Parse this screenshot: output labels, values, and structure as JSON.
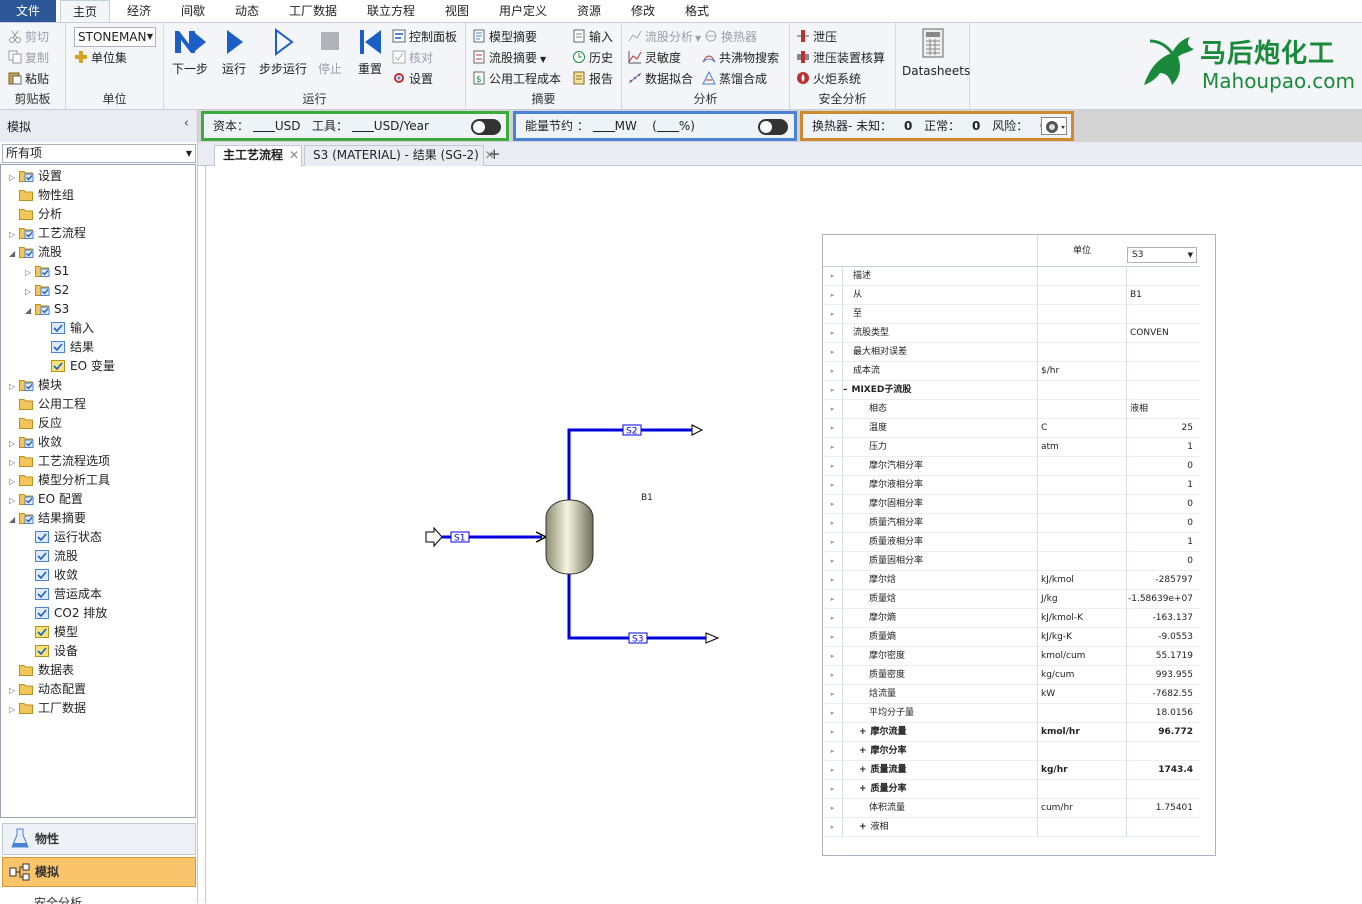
{
  "menu": {
    "file": "文件",
    "tabs": [
      "主页",
      "经济",
      "间歇",
      "动态",
      "工厂数据",
      "联立方程",
      "视图",
      "用户定义",
      "资源",
      "修改",
      "格式"
    ]
  },
  "ribbon": {
    "clipboard": {
      "label": "剪贴板",
      "cut": "剪切",
      "copy": "复制",
      "paste": "粘贴"
    },
    "units": {
      "label": "单位",
      "select": "STONEMAN",
      "unit_sets": "单位集"
    },
    "run": {
      "label": "运行",
      "next": "下一步",
      "run": "运行",
      "step": "步步运行",
      "stop": "停止",
      "reset": "重置",
      "control_panel": "控制面板",
      "check": "核对",
      "settings": "设置"
    },
    "summary": {
      "label": "摘要",
      "model_summary": "模型摘要",
      "stream_summary": "流股摘要",
      "utility_cost": "公用工程成本",
      "input": "输入",
      "history": "历史",
      "report": "报告"
    },
    "analysis": {
      "label": "分析",
      "stream_analysis": "流股分析",
      "hx": "换热器",
      "sensitivity": "灵敏度",
      "azeotrope": "共沸物搜索",
      "data_fit": "数据拟合",
      "distill_synth": "蒸馏合成"
    },
    "safety": {
      "label": "安全分析",
      "relief": "泄压",
      "relief_rating": "泄压装置核算",
      "flare": "火炬系统"
    },
    "datasheets": "Datasheets",
    "logo_cn": "马后炮化工",
    "logo_en": "Mahoupao.com"
  },
  "infobar": {
    "sidebar_title": "模拟",
    "capital_label": "资本：",
    "capital_unit": "USD",
    "utility_label": "工具：",
    "utility_unit": "USD/Year",
    "energy_label": "能量节约 ：",
    "energy_unit": "MW",
    "energy_pct": "%)",
    "energy_paren": "(",
    "hx_label": "换热器- 未知：",
    "hx_unknown": "0",
    "hx_ok_label": "正常：",
    "hx_ok": "0",
    "hx_risk_label": "风险：",
    "hx_risk": "0"
  },
  "sidebar": {
    "filter": "所有项",
    "tree": [
      {
        "label": "设置",
        "level": 0,
        "exp": "▷",
        "icon": "folder-check"
      },
      {
        "label": "物性组",
        "level": 0,
        "exp": "",
        "icon": "folder"
      },
      {
        "label": "分析",
        "level": 0,
        "exp": "",
        "icon": "folder"
      },
      {
        "label": "工艺流程",
        "level": 0,
        "exp": "▷",
        "icon": "folder-check"
      },
      {
        "label": "流股",
        "level": 0,
        "exp": "◢",
        "icon": "folder-check"
      },
      {
        "label": "S1",
        "level": 1,
        "exp": "▷",
        "icon": "folder-check"
      },
      {
        "label": "S2",
        "level": 1,
        "exp": "▷",
        "icon": "folder-check"
      },
      {
        "label": "S3",
        "level": 1,
        "exp": "◢",
        "icon": "folder-check"
      },
      {
        "label": "输入",
        "level": 2,
        "exp": "",
        "icon": "form-check"
      },
      {
        "label": "结果",
        "level": 2,
        "exp": "",
        "icon": "form"
      },
      {
        "label": "EO 变量",
        "level": 2,
        "exp": "",
        "icon": "form-yellow"
      },
      {
        "label": "模块",
        "level": 0,
        "exp": "▷",
        "icon": "folder-check"
      },
      {
        "label": "公用工程",
        "level": 0,
        "exp": "",
        "icon": "folder"
      },
      {
        "label": "反应",
        "level": 0,
        "exp": "",
        "icon": "folder"
      },
      {
        "label": "收敛",
        "level": 0,
        "exp": "▷",
        "icon": "folder-check"
      },
      {
        "label": "工艺流程选项",
        "level": 0,
        "exp": "▷",
        "icon": "folder"
      },
      {
        "label": "模型分析工具",
        "level": 0,
        "exp": "▷",
        "icon": "folder"
      },
      {
        "label": "EO 配置",
        "level": 0,
        "exp": "▷",
        "icon": "folder-check"
      },
      {
        "label": "结果摘要",
        "level": 0,
        "exp": "◢",
        "icon": "folder-check"
      },
      {
        "label": "运行状态",
        "level": 1,
        "exp": "",
        "icon": "form-check"
      },
      {
        "label": "流股",
        "level": 1,
        "exp": "",
        "icon": "form-check"
      },
      {
        "label": "收敛",
        "level": 1,
        "exp": "",
        "icon": "form"
      },
      {
        "label": "营运成本",
        "level": 1,
        "exp": "",
        "icon": "form-check"
      },
      {
        "label": "CO2 排放",
        "level": 1,
        "exp": "",
        "icon": "form-check"
      },
      {
        "label": "模型",
        "level": 1,
        "exp": "",
        "icon": "form-yellow"
      },
      {
        "label": "设备",
        "level": 1,
        "exp": "",
        "icon": "form-yellow"
      },
      {
        "label": "数据表",
        "level": 0,
        "exp": "",
        "icon": "folder"
      },
      {
        "label": "动态配置",
        "level": 0,
        "exp": "▷",
        "icon": "folder"
      },
      {
        "label": "工厂数据",
        "level": 0,
        "exp": "▷",
        "icon": "folder"
      }
    ],
    "nav_physical": "物性",
    "nav_simulation": "模拟",
    "nav_safety": "安全分析"
  },
  "doc_tabs": [
    {
      "label": "主工艺流程",
      "active": true
    },
    {
      "label": "S3 (MATERIAL) - 结果 (SG-2)",
      "active": false
    }
  ],
  "flowsheet": {
    "block": "B1",
    "streams": [
      "S1",
      "S2",
      "S3"
    ],
    "stream_color": "#0000dd"
  },
  "stream_table": {
    "unit_header": "单位",
    "selected_stream": "S3",
    "rows": [
      {
        "label": "描述",
        "unit": "",
        "value": "",
        "indent": 0,
        "exp": "▸",
        "bold": false,
        "align": "left"
      },
      {
        "label": "从",
        "unit": "",
        "value": "B1",
        "indent": 0,
        "exp": "▸",
        "bold": false,
        "align": "left"
      },
      {
        "label": "至",
        "unit": "",
        "value": "",
        "indent": 0,
        "exp": "▸",
        "bold": false,
        "align": "left"
      },
      {
        "label": "流股类型",
        "unit": "",
        "value": "CONVEN",
        "indent": 0,
        "exp": "▸",
        "bold": false,
        "align": "left"
      },
      {
        "label": "最大相对误差",
        "unit": "",
        "value": "",
        "indent": 0,
        "exp": "▸",
        "bold": false,
        "align": "left"
      },
      {
        "label": "成本流",
        "unit": "$/hr",
        "value": "",
        "indent": 0,
        "exp": "▸",
        "bold": false,
        "align": "left"
      },
      {
        "label": "MIXED子流股",
        "unit": "",
        "value": "",
        "indent": 0,
        "exp": "▸",
        "bold": true,
        "align": "left",
        "prefix": "–"
      },
      {
        "label": "相态",
        "unit": "",
        "value": "液相",
        "indent": 1,
        "exp": "▸",
        "bold": false,
        "align": "left"
      },
      {
        "label": "温度",
        "unit": "C",
        "value": "25",
        "indent": 1,
        "exp": "▸",
        "bold": false,
        "align": "right"
      },
      {
        "label": "压力",
        "unit": "atm",
        "value": "1",
        "indent": 1,
        "exp": "▸",
        "bold": false,
        "align": "right"
      },
      {
        "label": "摩尔汽相分率",
        "unit": "",
        "value": "0",
        "indent": 1,
        "exp": "▸",
        "bold": false,
        "align": "right"
      },
      {
        "label": "摩尔液相分率",
        "unit": "",
        "value": "1",
        "indent": 1,
        "exp": "▸",
        "bold": false,
        "align": "right"
      },
      {
        "label": "摩尔固相分率",
        "unit": "",
        "value": "0",
        "indent": 1,
        "exp": "▸",
        "bold": false,
        "align": "right"
      },
      {
        "label": "质量汽相分率",
        "unit": "",
        "value": "0",
        "indent": 1,
        "exp": "▸",
        "bold": false,
        "align": "right"
      },
      {
        "label": "质量液相分率",
        "unit": "",
        "value": "1",
        "indent": 1,
        "exp": "▸",
        "bold": false,
        "align": "right"
      },
      {
        "label": "质量固相分率",
        "unit": "",
        "value": "0",
        "indent": 1,
        "exp": "▸",
        "bold": false,
        "align": "right"
      },
      {
        "label": "摩尔焓",
        "unit": "kJ/kmol",
        "value": "-285797",
        "indent": 1,
        "exp": "▸",
        "bold": false,
        "align": "right"
      },
      {
        "label": "质量焓",
        "unit": "J/kg",
        "value": "-1.58639e+07",
        "indent": 1,
        "exp": "▸",
        "bold": false,
        "align": "right"
      },
      {
        "label": "摩尔熵",
        "unit": "kJ/kmol-K",
        "value": "-163.137",
        "indent": 1,
        "exp": "▸",
        "bold": false,
        "align": "right"
      },
      {
        "label": "质量熵",
        "unit": "kJ/kg-K",
        "value": "-9.0553",
        "indent": 1,
        "exp": "▸",
        "bold": false,
        "align": "right"
      },
      {
        "label": "摩尔密度",
        "unit": "kmol/cum",
        "value": "55.1719",
        "indent": 1,
        "exp": "▸",
        "bold": false,
        "align": "right"
      },
      {
        "label": "质量密度",
        "unit": "kg/cum",
        "value": "993.955",
        "indent": 1,
        "exp": "▸",
        "bold": false,
        "align": "right"
      },
      {
        "label": "焓流量",
        "unit": "kW",
        "value": "-7682.55",
        "indent": 1,
        "exp": "▸",
        "bold": false,
        "align": "right"
      },
      {
        "label": "平均分子量",
        "unit": "",
        "value": "18.0156",
        "indent": 1,
        "exp": "▸",
        "bold": false,
        "align": "right"
      },
      {
        "label": "摩尔流量",
        "unit": "kmol/hr",
        "value": "96.772",
        "indent": 1,
        "exp": "▸",
        "bold": true,
        "align": "right",
        "prefix": "+"
      },
      {
        "label": "摩尔分率",
        "unit": "",
        "value": "",
        "indent": 1,
        "exp": "▸",
        "bold": true,
        "align": "right",
        "prefix": "+"
      },
      {
        "label": "质量流量",
        "unit": "kg/hr",
        "value": "1743.4",
        "indent": 1,
        "exp": "▸",
        "bold": true,
        "align": "right",
        "prefix": "+"
      },
      {
        "label": "质量分率",
        "unit": "",
        "value": "",
        "indent": 1,
        "exp": "▸",
        "bold": true,
        "align": "right",
        "prefix": "+"
      },
      {
        "label": "体积流量",
        "unit": "cum/hr",
        "value": "1.75401",
        "indent": 1,
        "exp": "▸",
        "bold": false,
        "align": "right"
      },
      {
        "label": "液相",
        "unit": "",
        "value": "",
        "indent": 1,
        "exp": "▸",
        "bold": false,
        "align": "right",
        "prefix": "+"
      }
    ]
  }
}
